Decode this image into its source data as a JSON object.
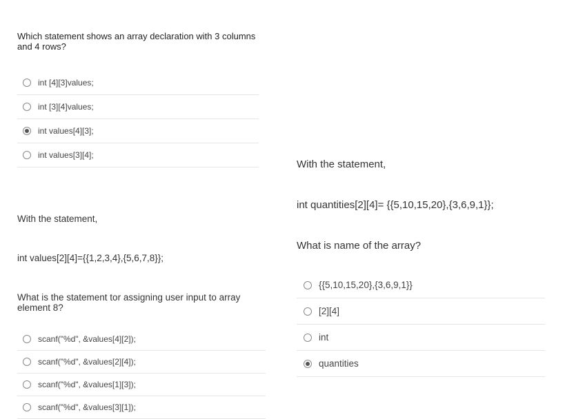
{
  "q1": {
    "prompt": "Which statement shows an array declaration with 3 columns and 4 rows?",
    "options": [
      "int [4][3]values;",
      "int [3][4]values;",
      "int values[4][3];",
      "int values[3][4];"
    ],
    "selected_index": 2
  },
  "q2": {
    "line1": "With the statement,",
    "line2": "int values[2][4]={{1,2,3,4},{5,6,7,8}};",
    "line3": "What is the statement tor assigning user input to array element 8?",
    "options": [
      "scanf(\"%d\", &values[4][2]);",
      "scanf(\"%d\", &values[2][4]);",
      "scanf(\"%d\", &values[1][3]);",
      "scanf(\"%d\", &values[3][1]);"
    ],
    "selected_index": -1
  },
  "q3": {
    "line1": "With the statement,",
    "line2": "int quantities[2][4]= {{5,10,15,20},{3,6,9,1}};",
    "line3": "What is name of the array?",
    "options": [
      "{{5,10,15,20},{3,6,9,1}}",
      "[2][4]",
      "int",
      "quantities"
    ],
    "selected_index": 3
  }
}
